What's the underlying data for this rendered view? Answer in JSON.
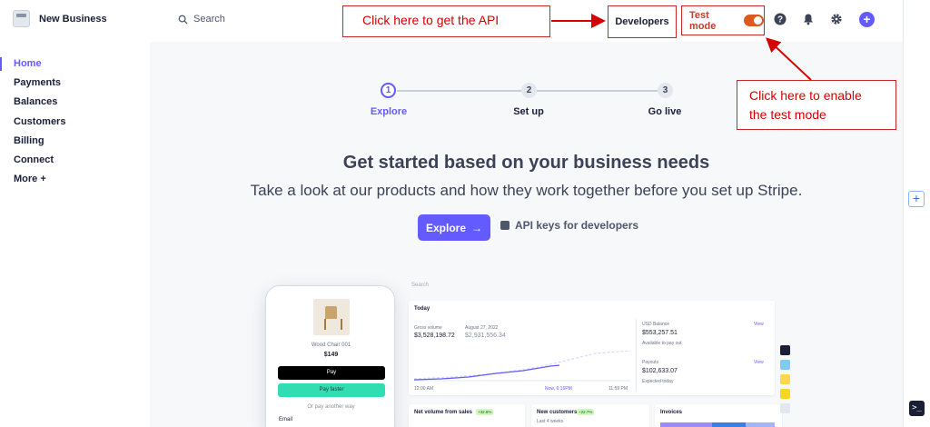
{
  "brand": {
    "name": "New Business"
  },
  "search": {
    "label": "Search"
  },
  "header": {
    "developers_label": "Developers",
    "test_mode_label": "Test mode",
    "test_mode_on": true,
    "accent": "#635bff",
    "test_color": "#dc5a1f"
  },
  "annotations": {
    "api": "Click here to get the API",
    "test_line1": "Click here to enable",
    "test_line2": "the test mode"
  },
  "sidebar": {
    "items": [
      {
        "label": "Home",
        "active": true
      },
      {
        "label": "Payments"
      },
      {
        "label": "Balances"
      },
      {
        "label": "Customers"
      },
      {
        "label": "Billing"
      },
      {
        "label": "Connect"
      },
      {
        "label": "More +"
      }
    ]
  },
  "steps": [
    {
      "number": "1",
      "label": "Explore",
      "active": true
    },
    {
      "number": "2",
      "label": "Set up"
    },
    {
      "number": "3",
      "label": "Go live"
    }
  ],
  "main": {
    "headline": "Get started based on your business needs",
    "subhead": "Take a look at our products and how they work together before you set up Stripe.",
    "explore_button": "Explore",
    "explore_arrow": "→",
    "api_link": "API keys for developers"
  },
  "phone": {
    "product": "Wood Chair 001",
    "price": "$149",
    "apple_pay": "Pay",
    "link_pay": "Pay faster",
    "or_pay": "Or pay another way",
    "email_label": "Email"
  },
  "dashboard": {
    "search": "Search",
    "today": "Today",
    "gross_volume_label": "Gross volume",
    "gross_volume": "$3,528,198.72",
    "compare_date": "August 27, 2022",
    "compare_value": "$2,931,556.34",
    "time_start": "12:00 AM",
    "time_now": "Now, 6:16PM",
    "time_end": "11:59 PM",
    "usd_balance_label": "USD Balance",
    "usd_balance": "$553,257.51",
    "available_label": "Available to pay out",
    "payouts_label": "Payouts",
    "payouts": "$102,633.07",
    "expected_label": "Expected today",
    "view": "View",
    "net_volume": "Net volume from sales",
    "net_badge": "+32.8%",
    "new_customers": "New customers",
    "cust_badge": "+22.7%",
    "last_weeks": "Last 4 weeks",
    "invoices": "Invoices"
  }
}
